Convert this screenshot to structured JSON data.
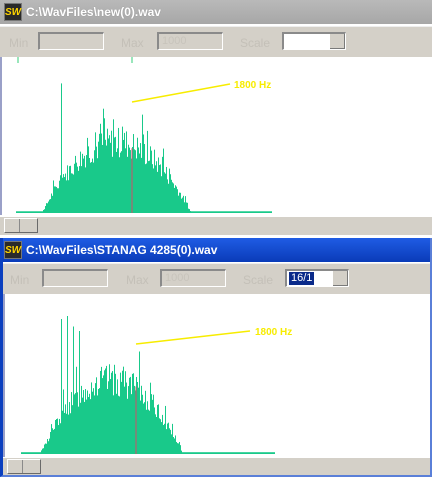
{
  "colors": {
    "spectrum": "#19c98a",
    "marker": "#d05068",
    "annotation": "#f7ec00",
    "tick": "#33cc77",
    "accent_title": "#0a3bb8"
  },
  "toolbar": {
    "min_label": "Min",
    "max_label": "Max",
    "scale_label": "Scale"
  },
  "windows": [
    {
      "title": "C:\\WavFiles\\new(0).wav",
      "icon_text": "SW",
      "max_value": "1000",
      "scale_value": "",
      "annotation": "1800 Hz",
      "spectrum_seed": 7,
      "tallest_peaks": [
        {
          "bin": 45,
          "level": 0.9
        },
        {
          "bin": 79,
          "level": 0.56
        }
      ]
    },
    {
      "title": "C:\\WavFiles\\STANAG 4285(0).wav",
      "icon_text": "SW",
      "max_value": "1000",
      "scale_value": "16/1",
      "annotation": "1800 Hz",
      "spectrum_seed": 13,
      "tallest_peaks": [
        {
          "bin": 40,
          "level": 0.9
        },
        {
          "bin": 46,
          "level": 0.92
        },
        {
          "bin": 52,
          "level": 0.85
        },
        {
          "bin": 58,
          "level": 0.82
        }
      ]
    }
  ]
}
